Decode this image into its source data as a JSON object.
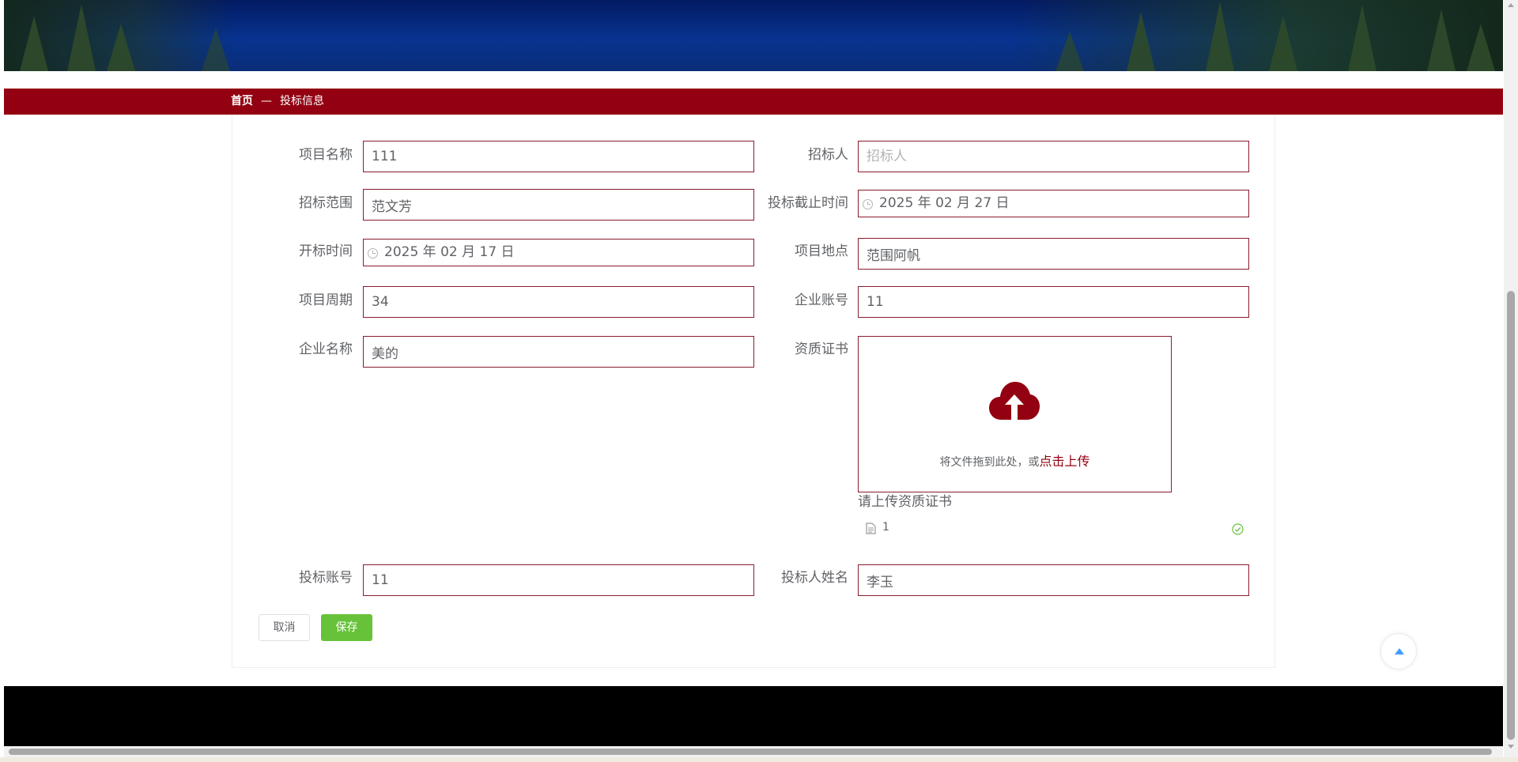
{
  "breadcrumb": {
    "home": "首页",
    "separator": "—",
    "current": "投标信息"
  },
  "form": {
    "project_name": {
      "label": "项目名称",
      "value": "111"
    },
    "tenderer": {
      "label": "招标人",
      "value": "",
      "placeholder": "招标人"
    },
    "tender_scope": {
      "label": "招标范围",
      "value": "范文芳"
    },
    "bid_deadline": {
      "label": "投标截止时间",
      "value": "2025 年 02 月 27 日"
    },
    "opening_time": {
      "label": "开标时间",
      "value": "2025 年 02 月 17 日"
    },
    "project_location": {
      "label": "项目地点",
      "value": "范围阿帆"
    },
    "project_period": {
      "label": "项目周期",
      "value": "34"
    },
    "company_account": {
      "label": "企业账号",
      "value": "11"
    },
    "company_name": {
      "label": "企业名称",
      "value": "美的"
    },
    "qualification": {
      "label": "资质证书",
      "upload_text": "将文件拖到此处，或",
      "upload_link": "点击上传",
      "tip": "请上传资质证书",
      "files": [
        {
          "name": "1",
          "status": "success"
        }
      ]
    },
    "bid_account": {
      "label": "投标账号",
      "value": "11"
    },
    "bidder_name": {
      "label": "投标人姓名",
      "value": "李玉"
    }
  },
  "buttons": {
    "cancel": "取消",
    "save": "保存"
  },
  "icons": {
    "upload": "cloud-upload-icon",
    "file": "document-icon",
    "success": "circle-check-icon",
    "back_top": "caret-top-icon",
    "clock": "clock-icon"
  },
  "colors": {
    "brand": "#930011",
    "success": "#67c23a",
    "link": "#409eff",
    "footer": "#000000"
  }
}
